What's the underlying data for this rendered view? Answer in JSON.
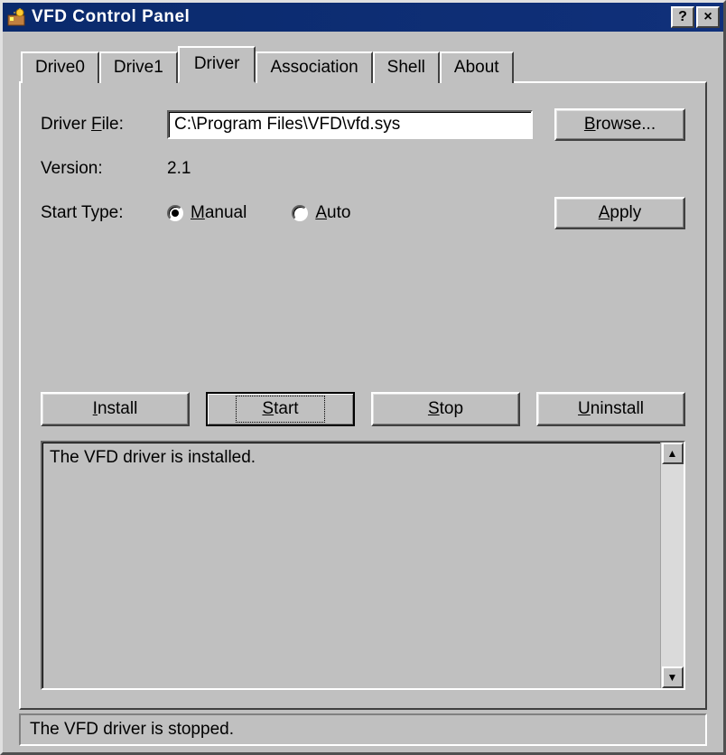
{
  "window": {
    "title": "VFD Control Panel",
    "help_glyph": "?",
    "close_glyph": "×"
  },
  "tabs": [
    {
      "label": "Drive0",
      "active": false
    },
    {
      "label": "Drive1",
      "active": false
    },
    {
      "label": "Driver",
      "active": true
    },
    {
      "label": "Association",
      "active": false
    },
    {
      "label": "Shell",
      "active": false
    },
    {
      "label": "About",
      "active": false
    }
  ],
  "driver": {
    "file_label_pre": "Driver ",
    "file_label_u": "F",
    "file_label_post": "ile:",
    "file_value": "C:\\Program Files\\VFD\\vfd.sys",
    "version_label": "Version:",
    "version_value": "2.1",
    "starttype_label": "Start Type:",
    "manual_u": "M",
    "manual_rest": "anual",
    "auto_u": "A",
    "auto_rest": "uto",
    "selected_start_type": "manual"
  },
  "buttons": {
    "browse_u": "B",
    "browse_rest": "rowse...",
    "apply_u": "A",
    "apply_rest": "pply",
    "install_u": "I",
    "install_rest": "nstall",
    "start_u": "S",
    "start_rest": "tart",
    "stop_u": "S",
    "stop_rest": "top",
    "uninstall_u": "U",
    "uninstall_rest": "ninstall"
  },
  "log": {
    "text": "The VFD driver is installed."
  },
  "status": {
    "text": "The VFD driver is stopped."
  },
  "arrows": {
    "up": "▲",
    "down": "▼"
  }
}
